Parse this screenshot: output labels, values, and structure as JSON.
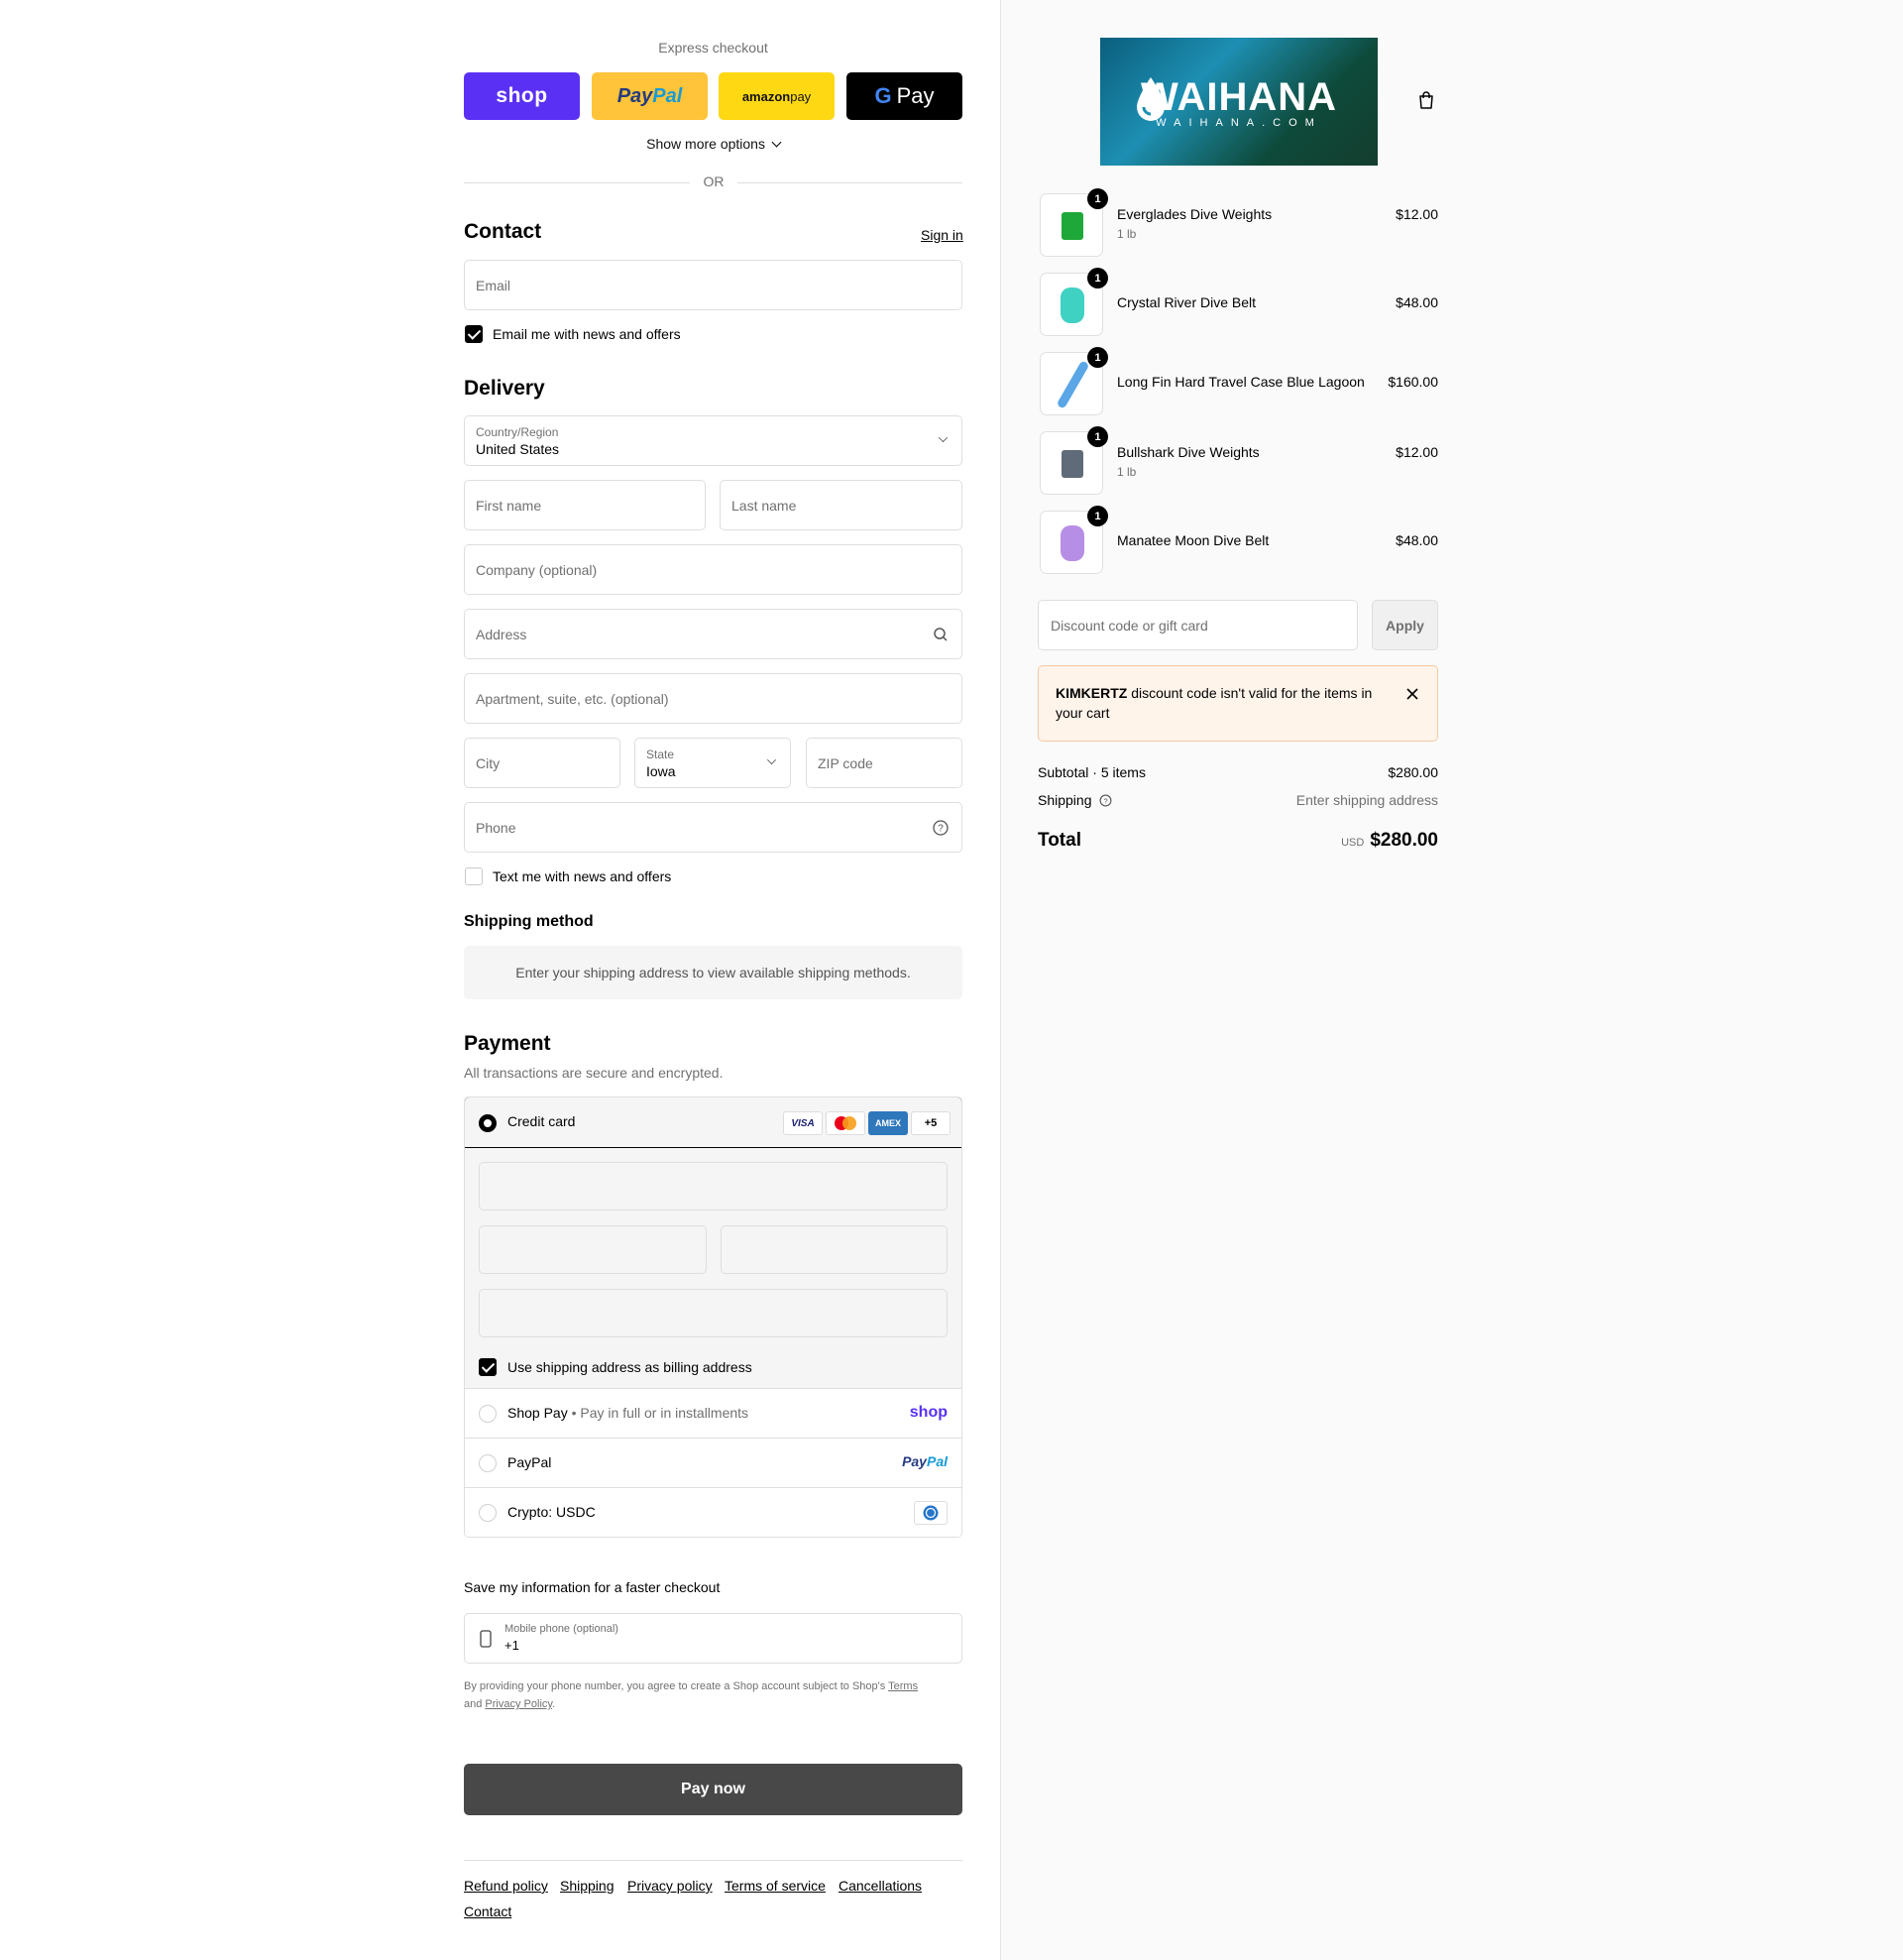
{
  "express": {
    "title": "Express checkout",
    "shop_label": "shop",
    "paypal_label_a": "Pay",
    "paypal_label_b": "Pal",
    "amazon_label_a": "amazon",
    "amazon_label_b": " pay",
    "gpay_label": "Pay",
    "more_options": "Show more options",
    "or": "OR"
  },
  "contact": {
    "title": "Contact",
    "sign_in": "Sign in",
    "email_placeholder": "Email",
    "news_label": "Email me with news and offers",
    "news_checked": true
  },
  "delivery": {
    "title": "Delivery",
    "country_label": "Country/Region",
    "country_value": "United States",
    "first_name": "First name",
    "last_name": "Last name",
    "company": "Company (optional)",
    "address": "Address",
    "apartment": "Apartment, suite, etc. (optional)",
    "city": "City",
    "state_label": "State",
    "state_value": "Iowa",
    "zip": "ZIP code",
    "phone": "Phone",
    "text_label": "Text me with news and offers",
    "text_checked": false
  },
  "shipping_method": {
    "title": "Shipping method",
    "message": "Enter your shipping address to view available shipping methods."
  },
  "payment": {
    "title": "Payment",
    "subtitle": "All transactions are secure and encrypted.",
    "credit_card": "Credit card",
    "brands": [
      "VISA",
      "",
      "AMEX",
      "+5"
    ],
    "billing_label": "Use shipping address as billing address",
    "shop_pay": "Shop Pay",
    "shop_pay_sub": "Pay in full or in installments",
    "shop_pay_logo": "shop",
    "paypal": "PayPal",
    "paypal_logo_a": "Pay",
    "paypal_logo_b": "Pal",
    "crypto": "Crypto: USDC"
  },
  "save_info": {
    "title": "Save my information for a faster checkout",
    "mobile_label": "Mobile phone (optional)",
    "mobile_value": "+1",
    "legal_a": "By providing your phone number, you agree to create a Shop account subject to Shop's ",
    "terms": "Terms",
    "legal_b": "and ",
    "privacy": "Privacy Policy",
    "legal_c": "."
  },
  "pay_now": "Pay now",
  "footer": {
    "links": [
      "Refund policy",
      "Shipping",
      "Privacy policy",
      "Terms of service",
      "Cancellations",
      "Contact"
    ]
  },
  "brand": {
    "logo_text": "WAIHANA",
    "logo_sub": "WAIHANA.COM"
  },
  "cart": {
    "items": [
      {
        "name": "Everglades Dive Weights",
        "variant": "1 lb",
        "price": "$12.00",
        "qty": "1",
        "color": "#1fa83a"
      },
      {
        "name": "Crystal River Dive Belt",
        "variant": "",
        "price": "$48.00",
        "qty": "1",
        "color": "#3fd1c2"
      },
      {
        "name": "Long Fin Hard Travel Case Blue Lagoon",
        "variant": "",
        "price": "$160.00",
        "qty": "1",
        "color": "#5aa6e6"
      },
      {
        "name": "Bullshark Dive Weights",
        "variant": "1 lb",
        "price": "$12.00",
        "qty": "1",
        "color": "#5f6b78"
      },
      {
        "name": "Manatee Moon Dive Belt",
        "variant": "",
        "price": "$48.00",
        "qty": "1",
        "color": "#b78ee6"
      }
    ],
    "discount_placeholder": "Discount code or gift card",
    "apply": "Apply",
    "alert_code": "KIMKERTZ",
    "alert_msg": " discount code isn't valid for the items in your cart",
    "subtotal_label": "Subtotal · 5 items",
    "subtotal_value": "$280.00",
    "shipping_label": "Shipping",
    "shipping_value": "Enter shipping address",
    "total_label": "Total",
    "currency": "USD",
    "total_value": "$280.00"
  }
}
